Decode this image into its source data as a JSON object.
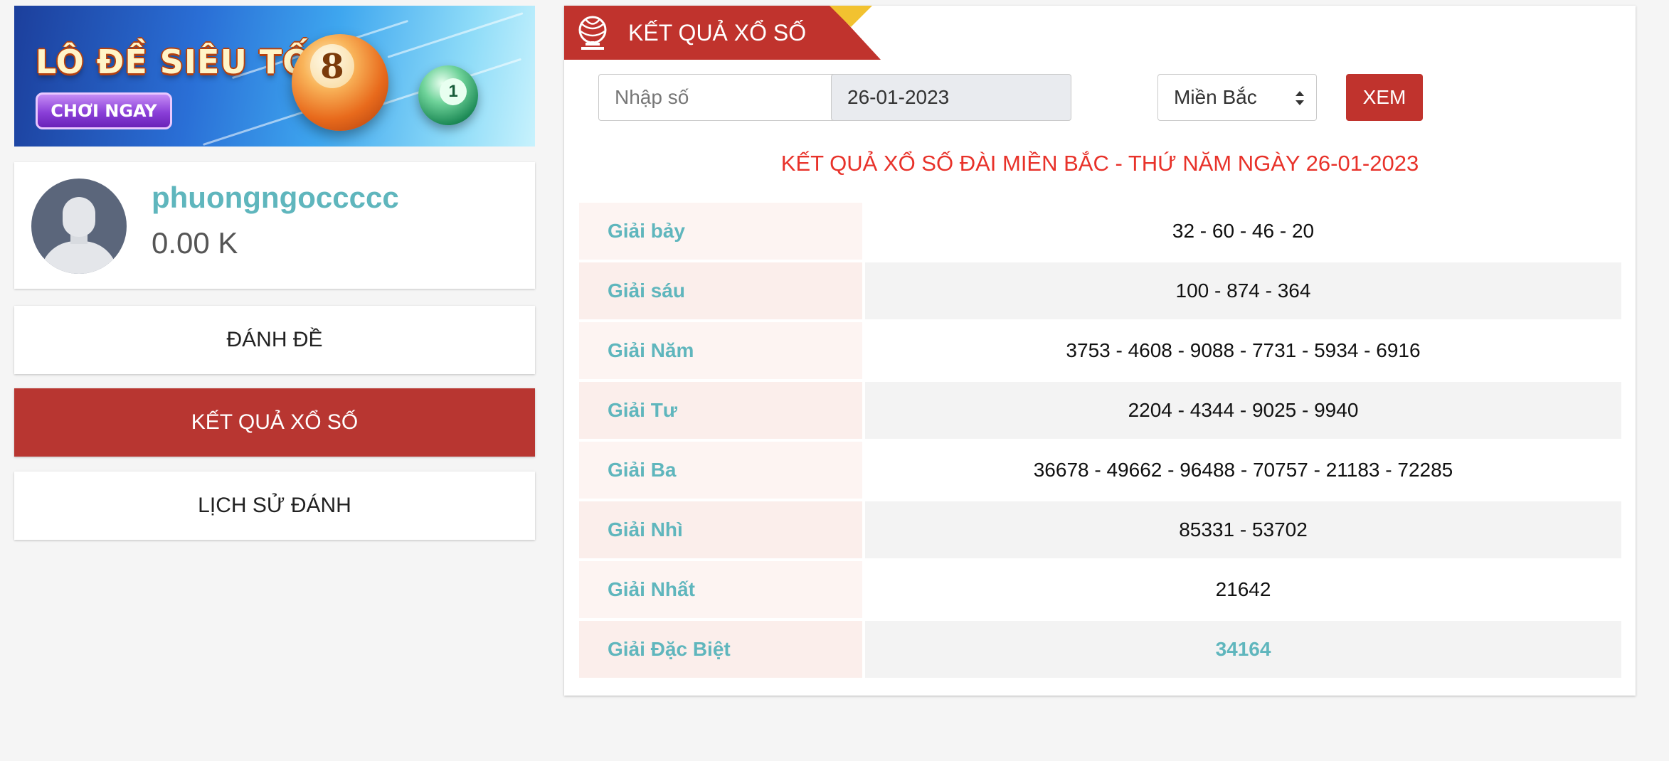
{
  "banner": {
    "title": "LÔ ĐỀ SIÊU TỐC",
    "button": "CHƠI NGAY",
    "ball_main": "8",
    "ball_small": "1"
  },
  "profile": {
    "username": "phuongngoccccc",
    "balance": "0.00 K"
  },
  "menu": {
    "items": [
      {
        "label": "ĐÁNH ĐỀ",
        "active": false
      },
      {
        "label": "KẾT QUẢ XỔ SỐ",
        "active": true
      },
      {
        "label": "LỊCH SỬ ĐÁNH",
        "active": false
      }
    ]
  },
  "panel": {
    "header_title": "KẾT QUẢ XỔ SỐ",
    "number_input_placeholder": "Nhập số",
    "date_value": "26-01-2023",
    "region_selected": "Miền Bắc",
    "view_button": "XEM",
    "result_title": "KẾT QUẢ XỔ SỐ ĐÀI MIỀN BẮC - THỨ NĂM NGÀY 26-01-2023"
  },
  "results": [
    {
      "prize": "Giải bảy",
      "numbers": "32 - 60 - 46 - 20"
    },
    {
      "prize": "Giải sáu",
      "numbers": "100 - 874 - 364"
    },
    {
      "prize": "Giải Năm",
      "numbers": "3753 - 4608 - 9088 - 7731 - 5934 - 6916"
    },
    {
      "prize": "Giải Tư",
      "numbers": "2204 - 4344 - 9025 - 9940"
    },
    {
      "prize": "Giải Ba",
      "numbers": "36678 - 49662 - 96488 - 70757 - 21183 - 72285"
    },
    {
      "prize": "Giải Nhì",
      "numbers": "85331 - 53702"
    },
    {
      "prize": "Giải Nhất",
      "numbers": "21642"
    },
    {
      "prize": "Giải Đặc Biệt",
      "numbers": "34164"
    }
  ],
  "colors": {
    "accent_red": "#c0332d",
    "teal": "#5fb6bd",
    "title_red": "#e8322a"
  }
}
